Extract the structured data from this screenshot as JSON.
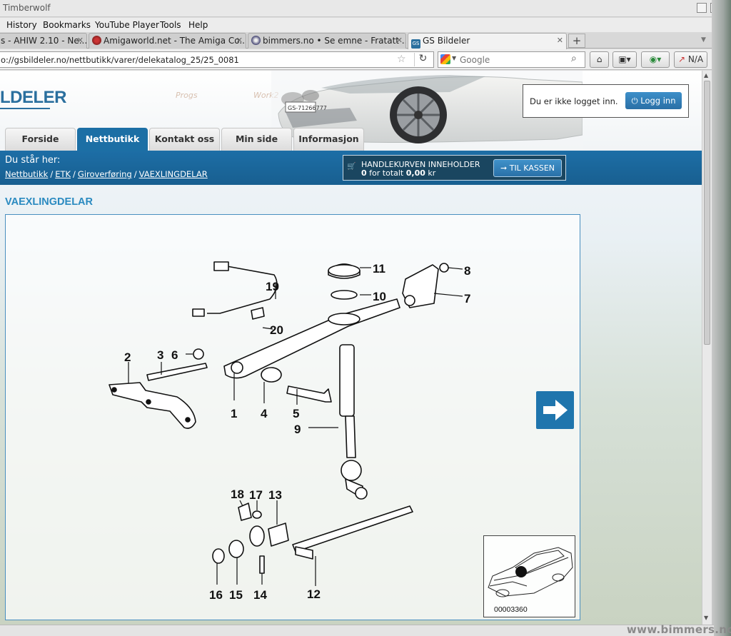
{
  "window": {
    "title": "Timberwolf"
  },
  "menu": [
    "History",
    "Bookmarks",
    "YouTube Player",
    "Tools",
    "Help"
  ],
  "tabs": [
    {
      "label": "s - AHIW 2.10 - Ne...",
      "active": false
    },
    {
      "label": "Amigaworld.net - The Amiga Co...",
      "active": false
    },
    {
      "label": "bimmers.no • Se emne - Fratatt ...",
      "active": false
    },
    {
      "label": "GS Bildeler",
      "active": true
    }
  ],
  "nav": {
    "url": "o://gsbildeler.no/nettbutikk/varer/delekatalog_25/25_0081",
    "search_placeholder": "Google",
    "extra_label": "N/A"
  },
  "site": {
    "logo": "LDELER",
    "ghost_icons": [
      "Progs",
      "Work2"
    ],
    "plate": "GS-71266777",
    "login_message": "Du er ikke logget inn.",
    "login_button": "Logg inn",
    "nav_tabs": [
      "Forside",
      "Nettbutikk",
      "Kontakt oss",
      "Min side",
      "Informasjon"
    ],
    "active_nav": "Nettbutikk",
    "you_are_here": "Du står her:",
    "breadcrumb": [
      "Nettbutikk",
      "ETK",
      "Giroverføring",
      "VAEXLINGDELAR"
    ],
    "cart_title": "HANDLEKURVEN INNEHOLDER",
    "cart_count": "0",
    "cart_mid": "for totalt",
    "cart_total": "0,00",
    "cart_currency": "kr",
    "checkout_button": "TIL KASSEN",
    "page_heading": "VAEXLINGDELAR",
    "diagram_code": "00003360",
    "part_numbers": [
      "1",
      "2",
      "3",
      "4",
      "5",
      "6",
      "7",
      "8",
      "9",
      "10",
      "11",
      "12",
      "13",
      "14",
      "15",
      "16",
      "17",
      "18",
      "19",
      "20"
    ]
  },
  "watermark": "www.bimmers.no"
}
